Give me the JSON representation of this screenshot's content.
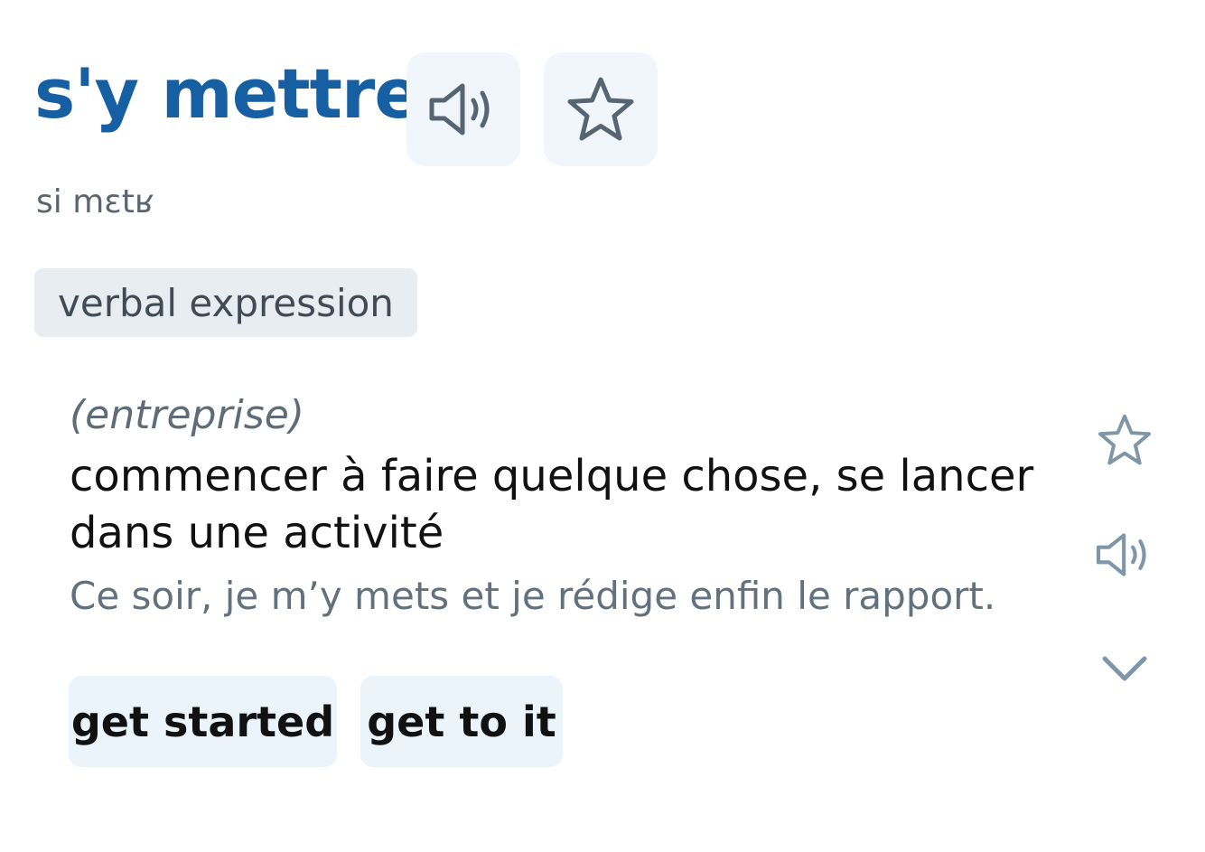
{
  "entry": {
    "headword": "s'y mettre",
    "phonetic": "si mɛtʁ",
    "part_of_speech": "verbal expression"
  },
  "sense": {
    "domain": "(entreprise)",
    "definition": "commencer à faire quelque chose, se lancer dans une activité",
    "example": "Ce soir, je m’y mets et je rédige enfin le rapport."
  },
  "translations": [
    "get started",
    "get to it"
  ],
  "icons": {
    "header_audio": "speaker-icon",
    "header_favorite": "star-outline-icon",
    "sense_favorite": "star-outline-icon",
    "sense_audio": "speaker-icon",
    "sense_expand": "chevron-down-icon"
  },
  "colors": {
    "headword": "#175fa3",
    "icon": "#556672",
    "icon_light": "#7f96a8",
    "chip_bg": "#ebf3fb",
    "tag_bg": "#e8edf1"
  }
}
